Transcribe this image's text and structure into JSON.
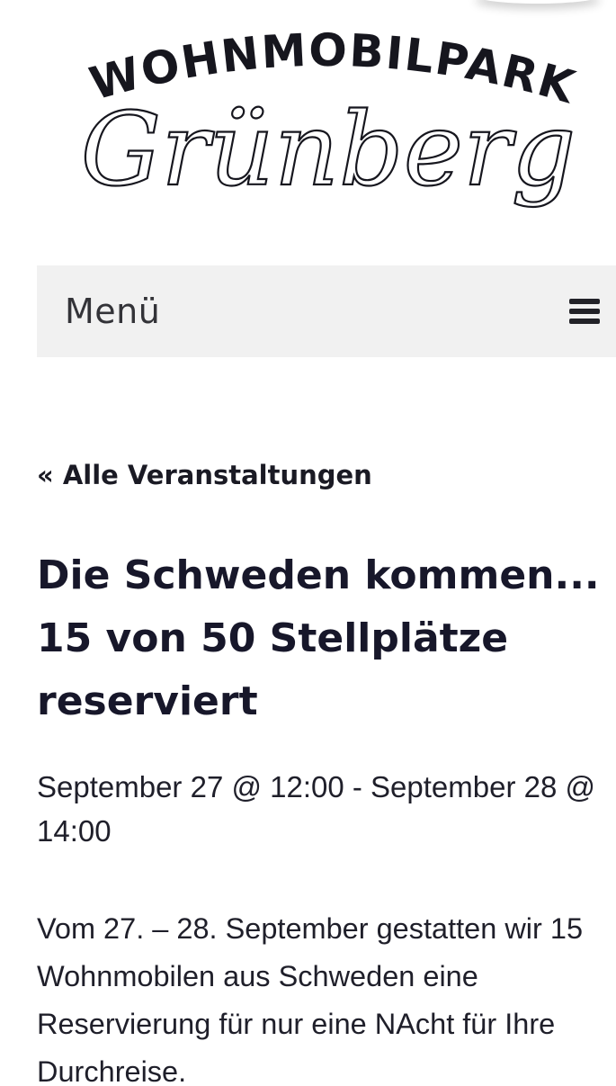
{
  "logo": {
    "arc_text": "WOHNMOBILPARK",
    "script_text": "Grünberg"
  },
  "menu": {
    "label": "Menü",
    "icon": "hamburger-icon"
  },
  "back_link": {
    "label": "« Alle Veranstaltungen"
  },
  "event": {
    "title": "Die Schweden kommen... 15 von 50 Stellplätze reserviert",
    "date": "September 27 @ 12:00 - September 28 @ 14:00",
    "description": "Vom 27. – 28. September gestatten wir 15 Wohnmobilen aus Schweden eine Reservierung für nur eine NAcht für Ihre Durchreise."
  },
  "colors": {
    "text": "#1a1a24",
    "menu_background": "#f1f1f1",
    "background": "#ffffff"
  }
}
